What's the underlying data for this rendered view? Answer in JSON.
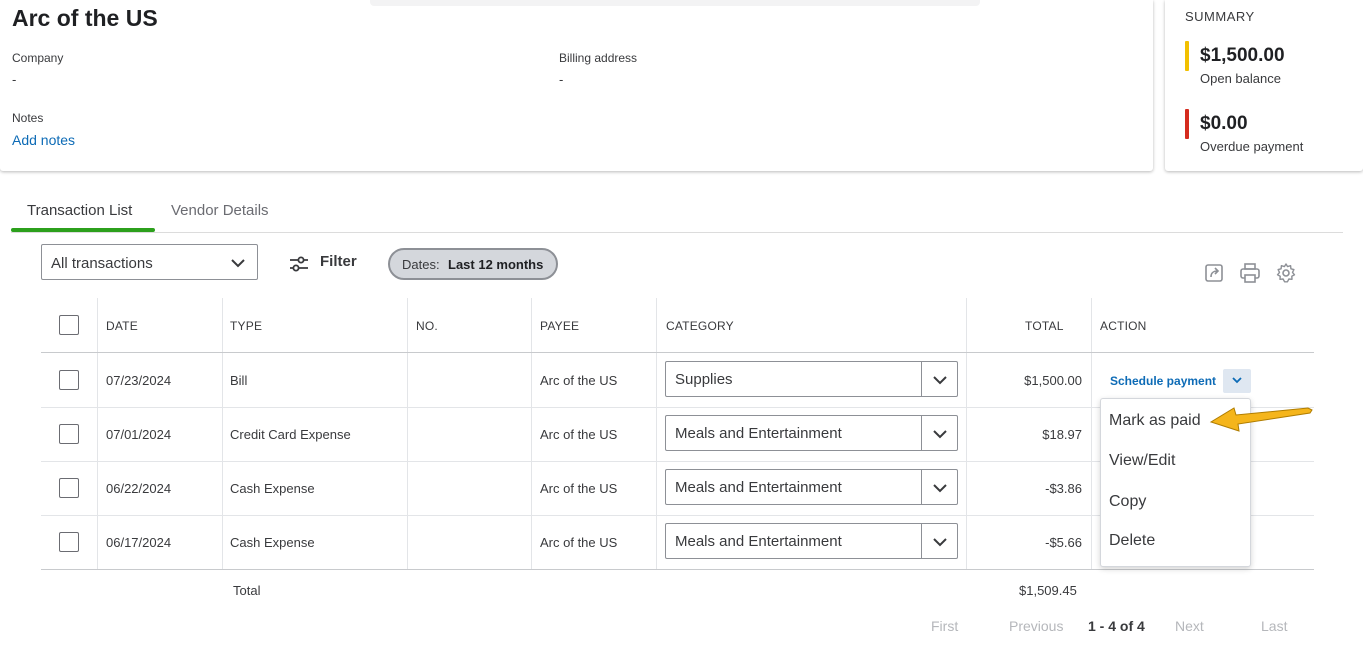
{
  "vendor": {
    "name": "Arc of the US",
    "company_label": "Company",
    "company_value": "-",
    "billing_label": "Billing address",
    "billing_value": "-",
    "notes_label": "Notes",
    "add_notes": "Add notes"
  },
  "summary": {
    "title": "SUMMARY",
    "open_amount": "$1,500.00",
    "open_label": "Open balance",
    "overdue_amount": "$0.00",
    "overdue_label": "Overdue payment",
    "open_color": "#f2c000",
    "overdue_color": "#d52b1e"
  },
  "tabs": [
    {
      "label": "Transaction List",
      "active": true
    },
    {
      "label": "Vendor Details",
      "active": false
    }
  ],
  "toolbar": {
    "type_filter": "All transactions",
    "filter_label": "Filter",
    "dates_prefix": "Dates:",
    "dates_value": "Last 12 months",
    "icons": [
      "export-icon",
      "print-icon",
      "settings-gear-icon"
    ]
  },
  "table": {
    "headers": {
      "date": "DATE",
      "type": "TYPE",
      "no": "NO.",
      "payee": "PAYEE",
      "category": "CATEGORY",
      "total": "TOTAL",
      "action": "ACTION"
    },
    "rows": [
      {
        "date": "07/23/2024",
        "type": "Bill",
        "no": "",
        "payee": "Arc of the US",
        "category": "Supplies",
        "total": "$1,500.00"
      },
      {
        "date": "07/01/2024",
        "type": "Credit Card Expense",
        "no": "",
        "payee": "Arc of the US",
        "category": "Meals and Entertainment",
        "total": "$18.97"
      },
      {
        "date": "06/22/2024",
        "type": "Cash Expense",
        "no": "",
        "payee": "Arc of the US",
        "category": "Meals and Entertainment",
        "total": "-$3.86"
      },
      {
        "date": "06/17/2024",
        "type": "Cash Expense",
        "no": "",
        "payee": "Arc of the US",
        "category": "Meals and Entertainment",
        "total": "-$5.66"
      }
    ],
    "total_label": "Total",
    "total_value": "$1,509.45",
    "row1_action": "Schedule payment"
  },
  "action_menu": [
    "Mark as paid",
    "View/Edit",
    "Copy",
    "Delete"
  ],
  "pager": {
    "first": "First",
    "previous": "Previous",
    "range": "1 - 4 of 4",
    "next": "Next",
    "last": "Last"
  },
  "colors": {
    "link": "#0d6bb6",
    "tab_active_underline": "#2ca01c",
    "callout_arrow": "#f5b51b"
  }
}
